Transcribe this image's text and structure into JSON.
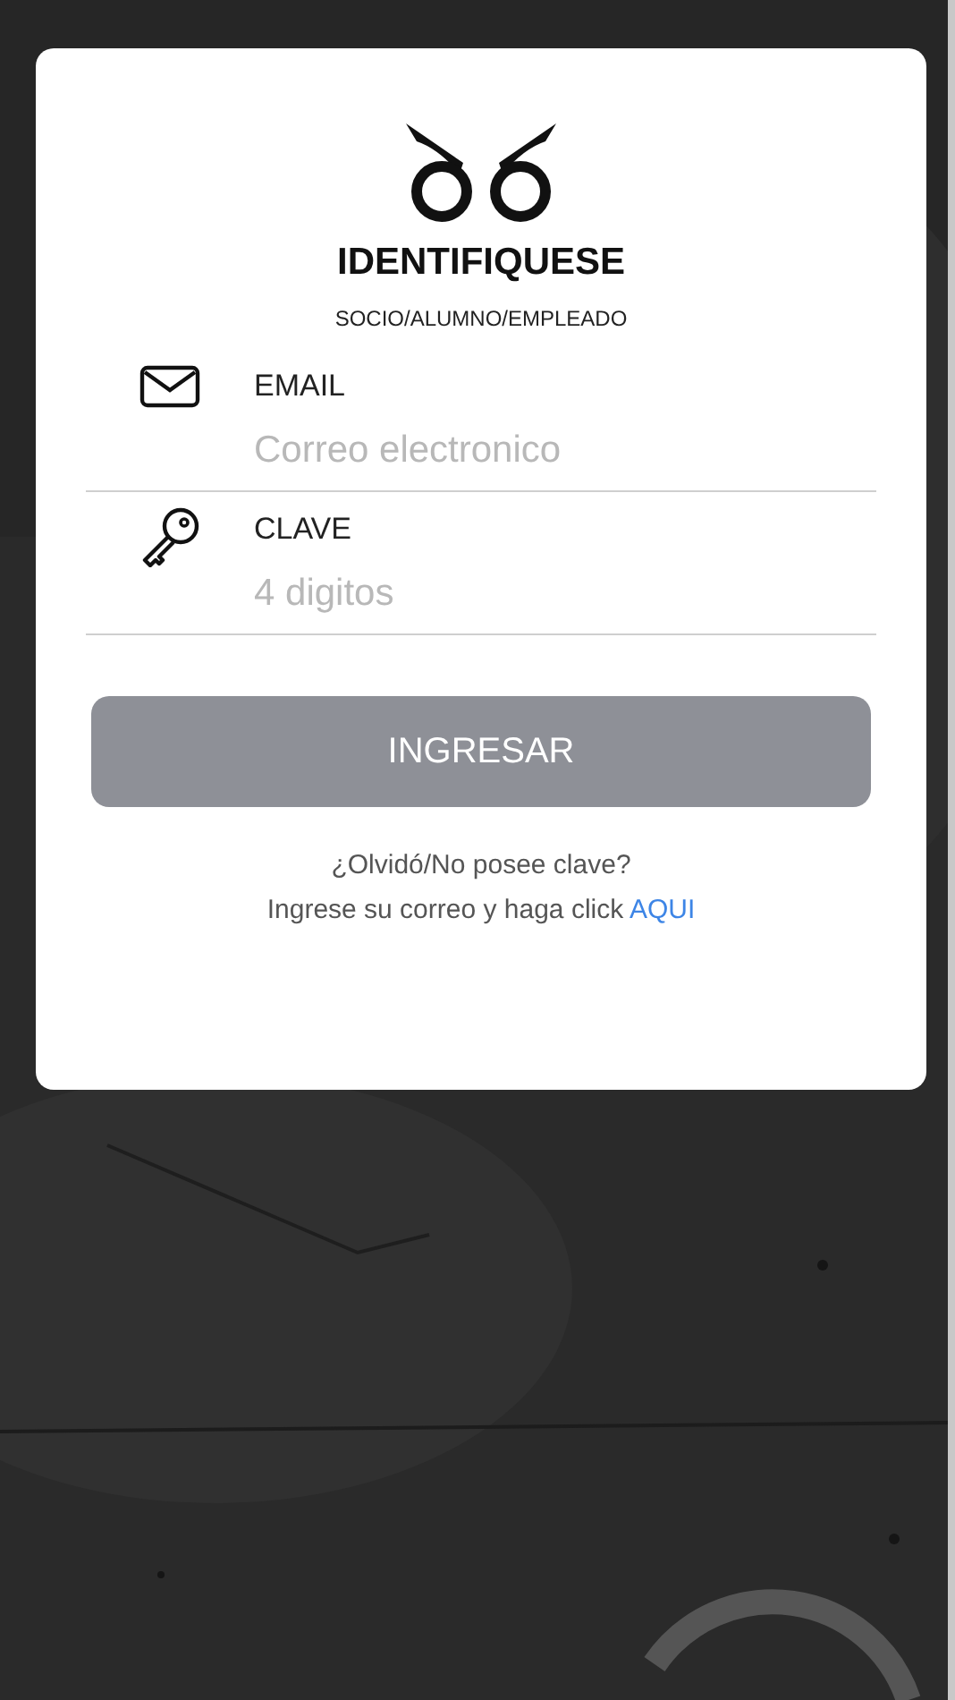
{
  "login": {
    "title": "IDENTIFIQUESE",
    "subtitle": "SOCIO/ALUMNO/EMPLEADO",
    "fields": [
      {
        "kind": "email",
        "label": "EMAIL",
        "placeholder": "Correo electronico"
      },
      {
        "kind": "key",
        "label": "CLAVE",
        "placeholder": "4 digitos"
      }
    ],
    "button": {
      "label": "INGRESAR",
      "disabled": true
    },
    "help_lines": [
      "¿Olvidó/No posee clave?",
      "Ingrese su correo y haga click"
    ],
    "help_link": "AQUI"
  }
}
